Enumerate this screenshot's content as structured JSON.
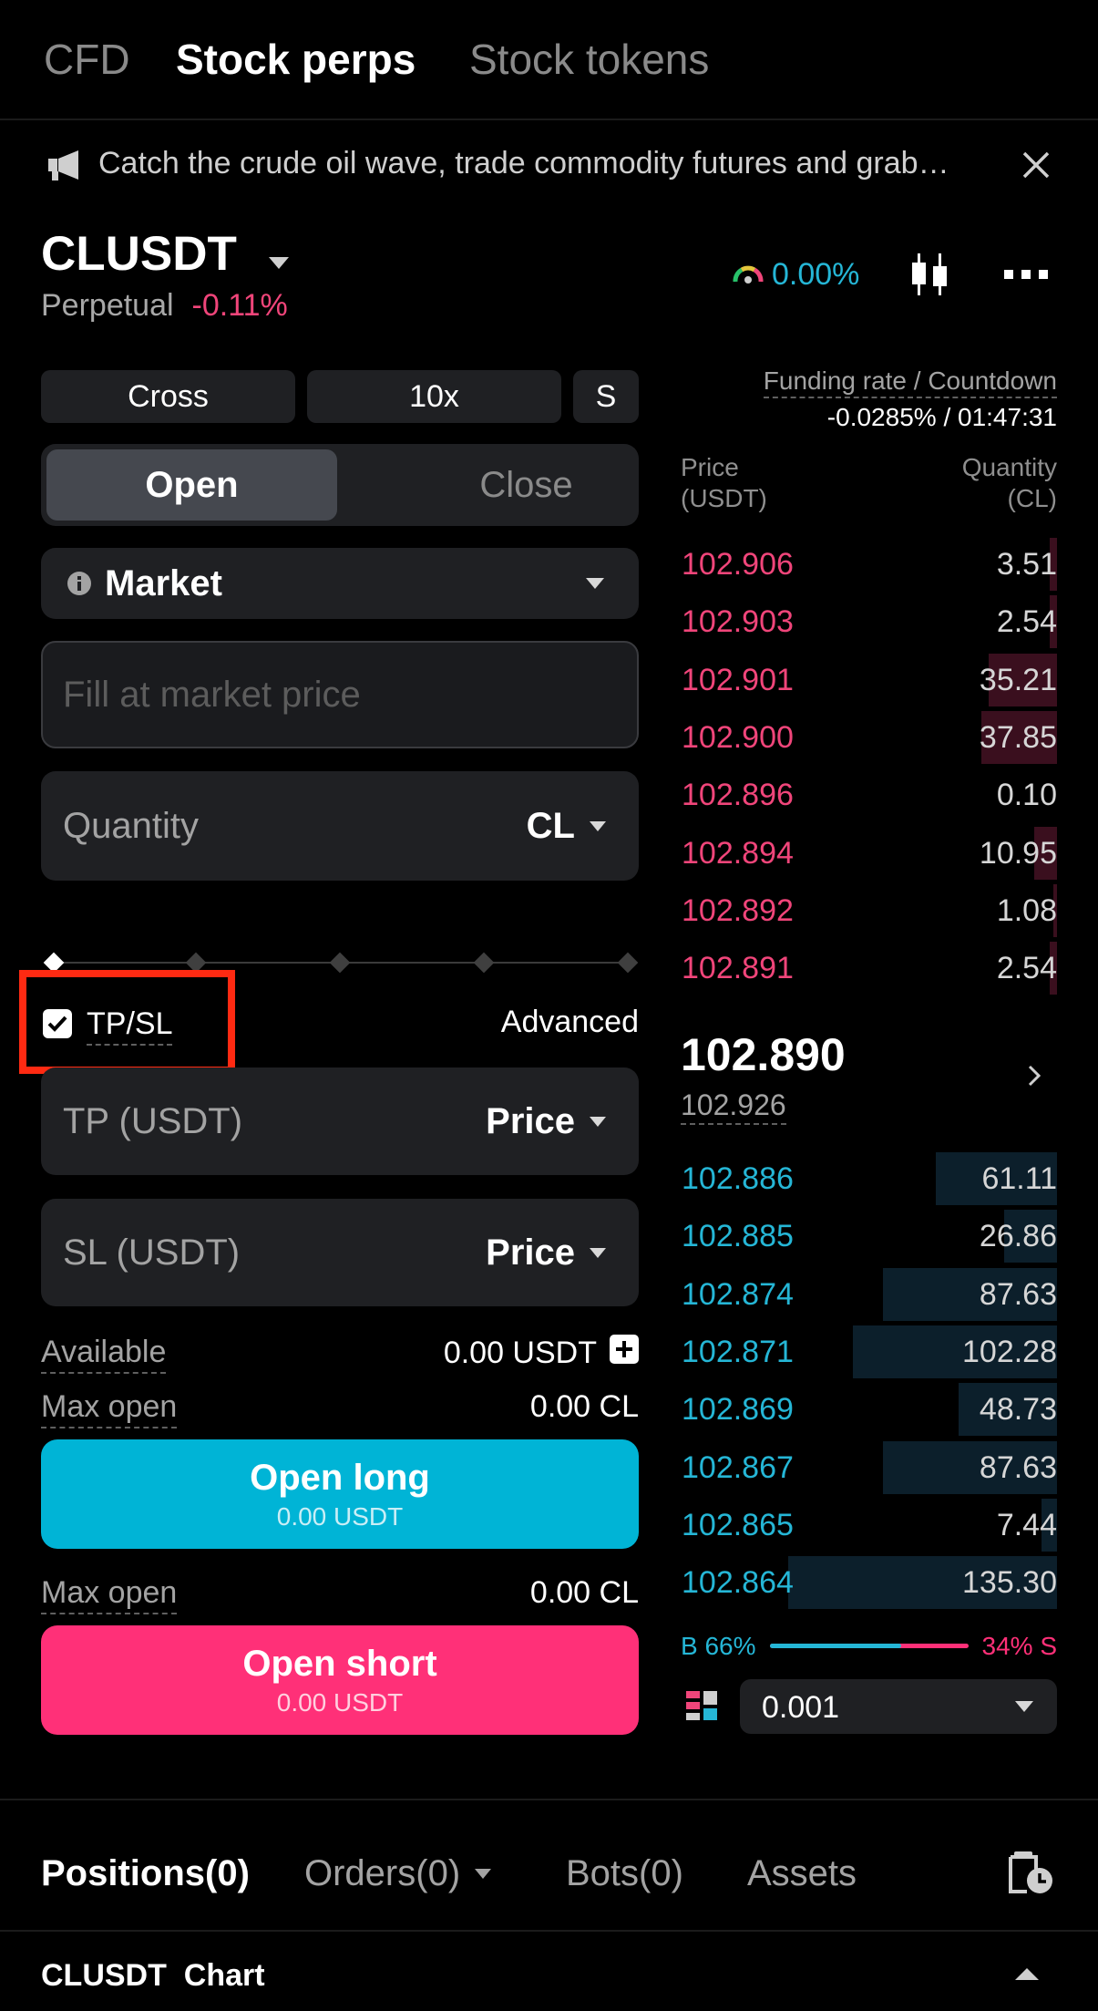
{
  "top_tabs": [
    {
      "label": "CFD"
    },
    {
      "label": "Stock perps"
    },
    {
      "label": "Stock tokens"
    }
  ],
  "banner": {
    "text": "Catch the crude oil wave, trade commodity futures and grab…"
  },
  "header": {
    "symbol": "CLUSDT",
    "contract_type": "Perpetual",
    "change": "-0.11%",
    "sentiment": "0.00%"
  },
  "controls": {
    "margin_mode": "Cross",
    "leverage": "10x",
    "size_mode": "S",
    "open_label": "Open",
    "close_label": "Close",
    "order_type": "Market",
    "price_placeholder": "Fill at market price",
    "quantity_label": "Quantity",
    "quantity_unit": "CL",
    "tpsl_label": "TP/SL",
    "tpsl_checked": true,
    "advanced_label": "Advanced",
    "tp_label": "TP (USDT)",
    "tp_mode": "Price",
    "sl_label": "SL (USDT)",
    "sl_mode": "Price",
    "available_label": "Available",
    "available_value": "0.00 USDT",
    "max_open_label": "Max open",
    "max_open_long": "0.00 CL",
    "max_open_short": "0.00 CL",
    "open_long_label": "Open long",
    "open_long_sub": "0.00 USDT",
    "open_short_label": "Open short",
    "open_short_sub": "0.00 USDT"
  },
  "funding": {
    "label": "Funding rate / Countdown",
    "value": "-0.0285% / 01:47:31"
  },
  "orderbook": {
    "price_header": [
      "Price",
      "(USDT)"
    ],
    "qty_header": [
      "Quantity",
      "(CL)"
    ],
    "asks": [
      {
        "price": "102.906",
        "qty": "3.51",
        "depth": 0.02
      },
      {
        "price": "102.903",
        "qty": "2.54",
        "depth": 0.02
      },
      {
        "price": "102.901",
        "qty": "35.21",
        "depth": 0.18
      },
      {
        "price": "102.900",
        "qty": "37.85",
        "depth": 0.2
      },
      {
        "price": "102.896",
        "qty": "0.10",
        "depth": 0.0
      },
      {
        "price": "102.894",
        "qty": "10.95",
        "depth": 0.06
      },
      {
        "price": "102.892",
        "qty": "1.08",
        "depth": 0.01
      },
      {
        "price": "102.891",
        "qty": "2.54",
        "depth": 0.02
      }
    ],
    "last_price": "102.890",
    "mark_price": "102.926",
    "bids": [
      {
        "price": "102.886",
        "qty": "61.11",
        "depth": 0.32
      },
      {
        "price": "102.885",
        "qty": "26.86",
        "depth": 0.14
      },
      {
        "price": "102.874",
        "qty": "87.63",
        "depth": 0.46
      },
      {
        "price": "102.871",
        "qty": "102.28",
        "depth": 0.54
      },
      {
        "price": "102.869",
        "qty": "48.73",
        "depth": 0.26
      },
      {
        "price": "102.867",
        "qty": "87.63",
        "depth": 0.46
      },
      {
        "price": "102.865",
        "qty": "7.44",
        "depth": 0.04
      },
      {
        "price": "102.864",
        "qty": "135.30",
        "depth": 0.71
      }
    ],
    "buy_ratio": "B 66%",
    "sell_ratio": "34% S",
    "buy_fraction": 0.66,
    "precision": "0.001"
  },
  "bottom_tabs": [
    {
      "label": "Positions(0)"
    },
    {
      "label": "Orders(0)"
    },
    {
      "label": "Bots(0)"
    },
    {
      "label": "Assets"
    }
  ],
  "footer": {
    "symbol": "CLUSDT",
    "chart_label": "Chart"
  },
  "colors": {
    "ask": "#f0457a",
    "bid": "#25b6d6",
    "long": "#00b4d6",
    "short": "#ff3078",
    "highlight": "#ff2a12"
  }
}
